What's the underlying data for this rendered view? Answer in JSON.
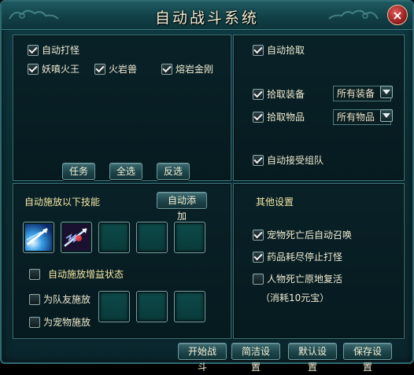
{
  "window": {
    "title": "自动战斗系统",
    "close_glyph": "×"
  },
  "colors": {
    "accent_gold": "#f5e7a4",
    "panel_border": "#3d7276",
    "bg": "#0b2c33"
  },
  "auto_attack": {
    "label": "自动打怪",
    "checked": true,
    "monsters": [
      {
        "label": "妖嗔火王",
        "checked": true
      },
      {
        "label": "火岩兽",
        "checked": true
      },
      {
        "label": "熔岩金刚",
        "checked": true
      }
    ],
    "buttons": {
      "task": "任务",
      "select_all": "全选",
      "invert": "反选"
    }
  },
  "auto_pickup": {
    "label": "自动拾取",
    "checked": true,
    "equipment": {
      "label": "拾取装备",
      "checked": true,
      "value": "所有装备"
    },
    "items": {
      "label": "拾取物品",
      "checked": true,
      "value": "所有物品"
    },
    "accept_team": {
      "label": "自动接受组队",
      "checked": true
    }
  },
  "skills": {
    "heading": "自动施放以下技能",
    "auto_add": "自动添加",
    "slots": [
      {
        "icon": "ice-arrow-skill-icon",
        "filled": true
      },
      {
        "icon": "lightning-arrow-skill-icon",
        "filled": true
      },
      {
        "filled": false
      },
      {
        "filled": false
      },
      {
        "filled": false
      }
    ],
    "auto_buff": {
      "label": "自动施放增益状态",
      "checked": false
    },
    "for_teammate": {
      "label": "为队友施放",
      "checked": false
    },
    "for_pet": {
      "label": "为宠物施放",
      "checked": false
    },
    "buff_slots": [
      {
        "filled": false
      },
      {
        "filled": false
      },
      {
        "filled": false
      }
    ]
  },
  "other": {
    "heading": "其他设置",
    "pet_resummon": {
      "label": "宠物死亡后自动召唤",
      "checked": true
    },
    "stop_on_empty": {
      "label": "药品耗尽停止打怪",
      "checked": true
    },
    "revive_in_place": {
      "label": "人物死亡原地复活",
      "checked": false
    },
    "revive_cost": "（消耗10元宝）"
  },
  "footer": {
    "start": "开始战斗",
    "simple": "简洁设置",
    "default": "默认设置",
    "save": "保存设置"
  }
}
